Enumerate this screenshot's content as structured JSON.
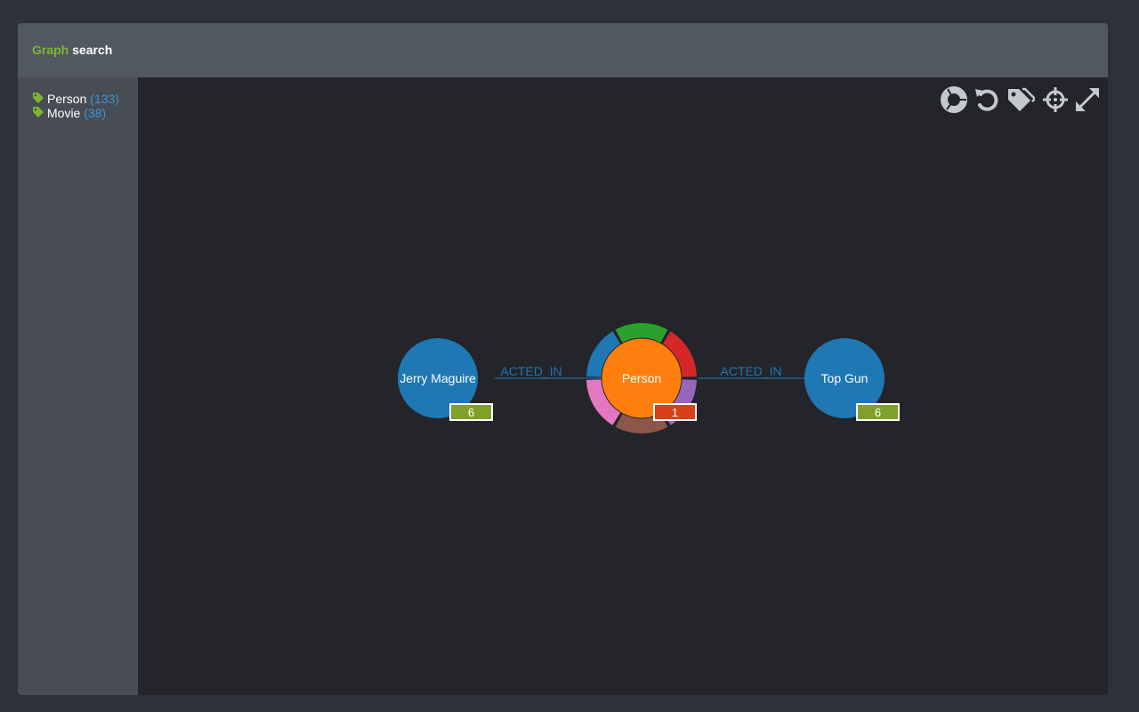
{
  "header": {
    "title_part1": "Graph",
    "title_part2": "search"
  },
  "sidebar": {
    "labels": [
      {
        "name": "Person",
        "count": "(133)",
        "icon": "tag-icon"
      },
      {
        "name": "Movie",
        "count": "(38)",
        "icon": "tag-icon"
      }
    ]
  },
  "toolbar": {
    "icons": [
      "donut-icon",
      "undo-icon",
      "tags-icon",
      "crosshair-icon",
      "expand-icon"
    ]
  },
  "graph": {
    "nodes": [
      {
        "id": "jerry",
        "label": "Jerry Maguire",
        "type": "Movie",
        "badge": "6",
        "color": "#1f77b4",
        "badge_color": "#7fa12a"
      },
      {
        "id": "person",
        "label": "Person",
        "type": "Person",
        "badge": "1",
        "color": "#ff7f0e",
        "badge_color": "#d9401a"
      },
      {
        "id": "topgun",
        "label": "Top Gun",
        "type": "Movie",
        "badge": "6",
        "color": "#1f77b4",
        "badge_color": "#7fa12a"
      }
    ],
    "relationships": [
      {
        "from": "person",
        "to": "jerry",
        "label": "ACTED_IN"
      },
      {
        "from": "person",
        "to": "topgun",
        "label": "ACTED_IN"
      }
    ],
    "ring_colors": [
      "#2ca02c",
      "#d62728",
      "#9467bd",
      "#8c564b",
      "#e377c2",
      "#1f77b4"
    ]
  },
  "colors": {
    "accent_green": "#7fb72c",
    "count_blue": "#3a97d6",
    "icon_gray": "#c5c8cc"
  }
}
